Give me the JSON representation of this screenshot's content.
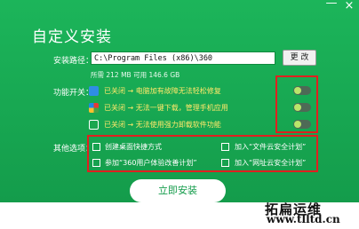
{
  "window": {
    "title": "自定义安装",
    "minimize_glyph": "—",
    "close_glyph": "×"
  },
  "install_path": {
    "label": "安装路径：",
    "value": "C:\\Program Files (x86)\\360",
    "change_label": "更 改",
    "space_info": "所需 212 MB  可用 146.6 GB"
  },
  "features": {
    "label": "功能开关：",
    "items": [
      {
        "text": "已关闭 → 电脑加有故障无法轻松修复",
        "icon": "computer-repair-icon"
      },
      {
        "text": "已关闭 → 无法一键下载，管理手机应用",
        "icon": "phone-app-icon"
      },
      {
        "text": "已关闭 → 无法使用强力卸载软件功能",
        "icon": "uninstall-icon"
      }
    ]
  },
  "options": {
    "label": "其他选项：",
    "items": [
      {
        "text": "创建桌面快捷方式"
      },
      {
        "text": "加入“文件云安全计划”"
      },
      {
        "text": "参加“360用户体验改善计划”"
      },
      {
        "text": "加入“网址云安全计划”"
      }
    ]
  },
  "actions": {
    "install_label": "立即安装"
  },
  "watermark": {
    "text": "拓扁运维",
    "url": "www.tlltd.cn"
  },
  "colors": {
    "background": "#17a651",
    "highlight_box": "#e02020",
    "disabled_text": "#ffe86a"
  }
}
